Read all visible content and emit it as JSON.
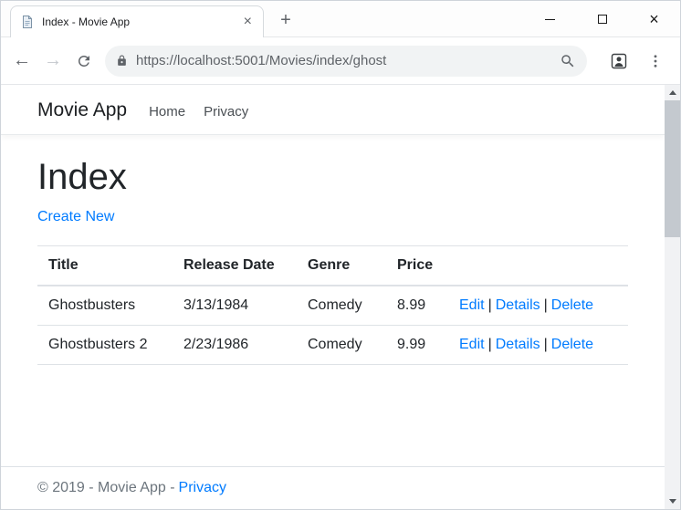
{
  "browser": {
    "tab": {
      "title": "Index - Movie App",
      "close": "×"
    },
    "new_tab": "+",
    "window_controls": {
      "close": "×"
    },
    "toolbar": {
      "back": "←",
      "forward": "→",
      "url": "https://localhost:5001/Movies/index/ghost"
    }
  },
  "page": {
    "navbar": {
      "brand": "Movie App",
      "links": [
        {
          "label": "Home"
        },
        {
          "label": "Privacy"
        }
      ]
    },
    "main": {
      "heading": "Index",
      "create_link": "Create New",
      "table": {
        "headers": [
          "Title",
          "Release Date",
          "Genre",
          "Price",
          ""
        ],
        "action_separator": "|",
        "rows": [
          {
            "title": "Ghostbusters",
            "release_date": "3/13/1984",
            "genre": "Comedy",
            "price": "8.99",
            "actions": [
              "Edit",
              "Details",
              "Delete"
            ]
          },
          {
            "title": "Ghostbusters 2",
            "release_date": "2/23/1986",
            "genre": "Comedy",
            "price": "9.99",
            "actions": [
              "Edit",
              "Details",
              "Delete"
            ]
          }
        ]
      }
    },
    "footer": {
      "text": "© 2019 - Movie App -",
      "privacy": "Privacy"
    }
  },
  "colors": {
    "link": "#007bff",
    "muted_text": "#6c757d",
    "table_border": "#dee2e6",
    "chrome_icon": "#5f6368",
    "omnibox_bg": "#f1f3f4"
  }
}
